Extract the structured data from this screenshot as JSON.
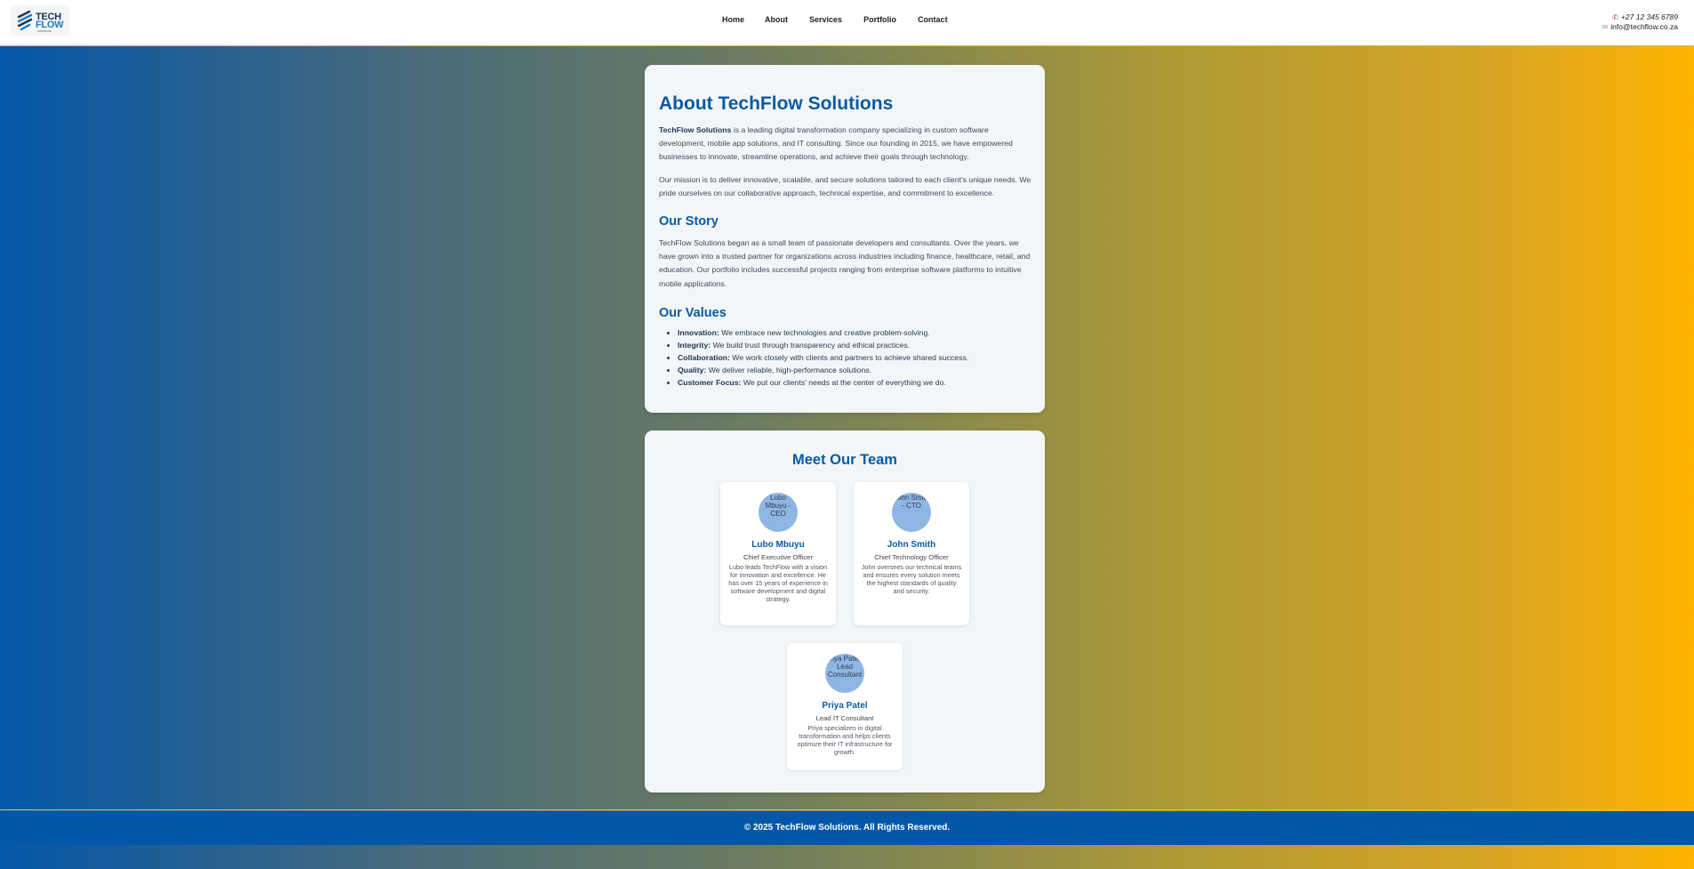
{
  "header": {
    "logo": {
      "line1": "TECH",
      "line2": "FLOW",
      "line3": "solutions"
    },
    "nav": [
      {
        "label": "Home"
      },
      {
        "label": "About"
      },
      {
        "label": "Services"
      },
      {
        "label": "Portfolio"
      },
      {
        "label": "Contact"
      }
    ],
    "phone": "+27 12 345 6789",
    "email": "info@techflow.co.za"
  },
  "about": {
    "title": "About TechFlow Solutions",
    "p1_strong": "TechFlow Solutions",
    "p1_rest": " is a leading digital transformation company specializing in custom software development, mobile app solutions, and IT consulting. Since our founding in 2015, we have empowered businesses to innovate, streamline operations, and achieve their goals through technology.",
    "p2": "Our mission is to deliver innovative, scalable, and secure solutions tailored to each client's unique needs. We pride ourselves on our collaborative approach, technical expertise, and commitment to excellence.",
    "story_title": "Our Story",
    "story": "TechFlow Solutions began as a small team of passionate developers and consultants. Over the years, we have grown into a trusted partner for organizations across industries including finance, healthcare, retail, and education. Our portfolio includes successful projects ranging from enterprise software platforms to intuitive mobile applications.",
    "values_title": "Our Values",
    "values": [
      {
        "name": "Innovation:",
        "text": " We embrace new technologies and creative problem-solving."
      },
      {
        "name": "Integrity:",
        "text": " We build trust through transparency and ethical practices."
      },
      {
        "name": "Collaboration:",
        "text": " We work closely with clients and partners to achieve shared success."
      },
      {
        "name": "Quality:",
        "text": " We deliver reliable, high-performance solutions."
      },
      {
        "name": "Customer Focus:",
        "text": " We put our clients' needs at the center of everything we do."
      }
    ]
  },
  "team": {
    "title": "Meet Our Team",
    "members": [
      {
        "alt": "Lubo Mbuyu - CEO",
        "name": "Lubo Mbuyu",
        "role": "Chief Executive Officer",
        "bio": "Lubo leads TechFlow with a vision for innovation and excellence. He has over 15 years of experience in software development and digital strategy."
      },
      {
        "alt": "John Smith - CTO",
        "name": "John Smith",
        "role": "Chief Technology Officer",
        "bio": "John oversees our technical teams and ensures every solution meets the highest standards of quality and security."
      },
      {
        "alt": "Priya Patel - Lead Consultant",
        "name": "Priya Patel",
        "role": "Lead IT Consultant",
        "bio": "Priya specializes in digital transformation and helps clients optimize their IT infrastructure for growth."
      }
    ]
  },
  "footer": {
    "text": "© 2025 TechFlow Solutions. All Rights Reserved."
  }
}
